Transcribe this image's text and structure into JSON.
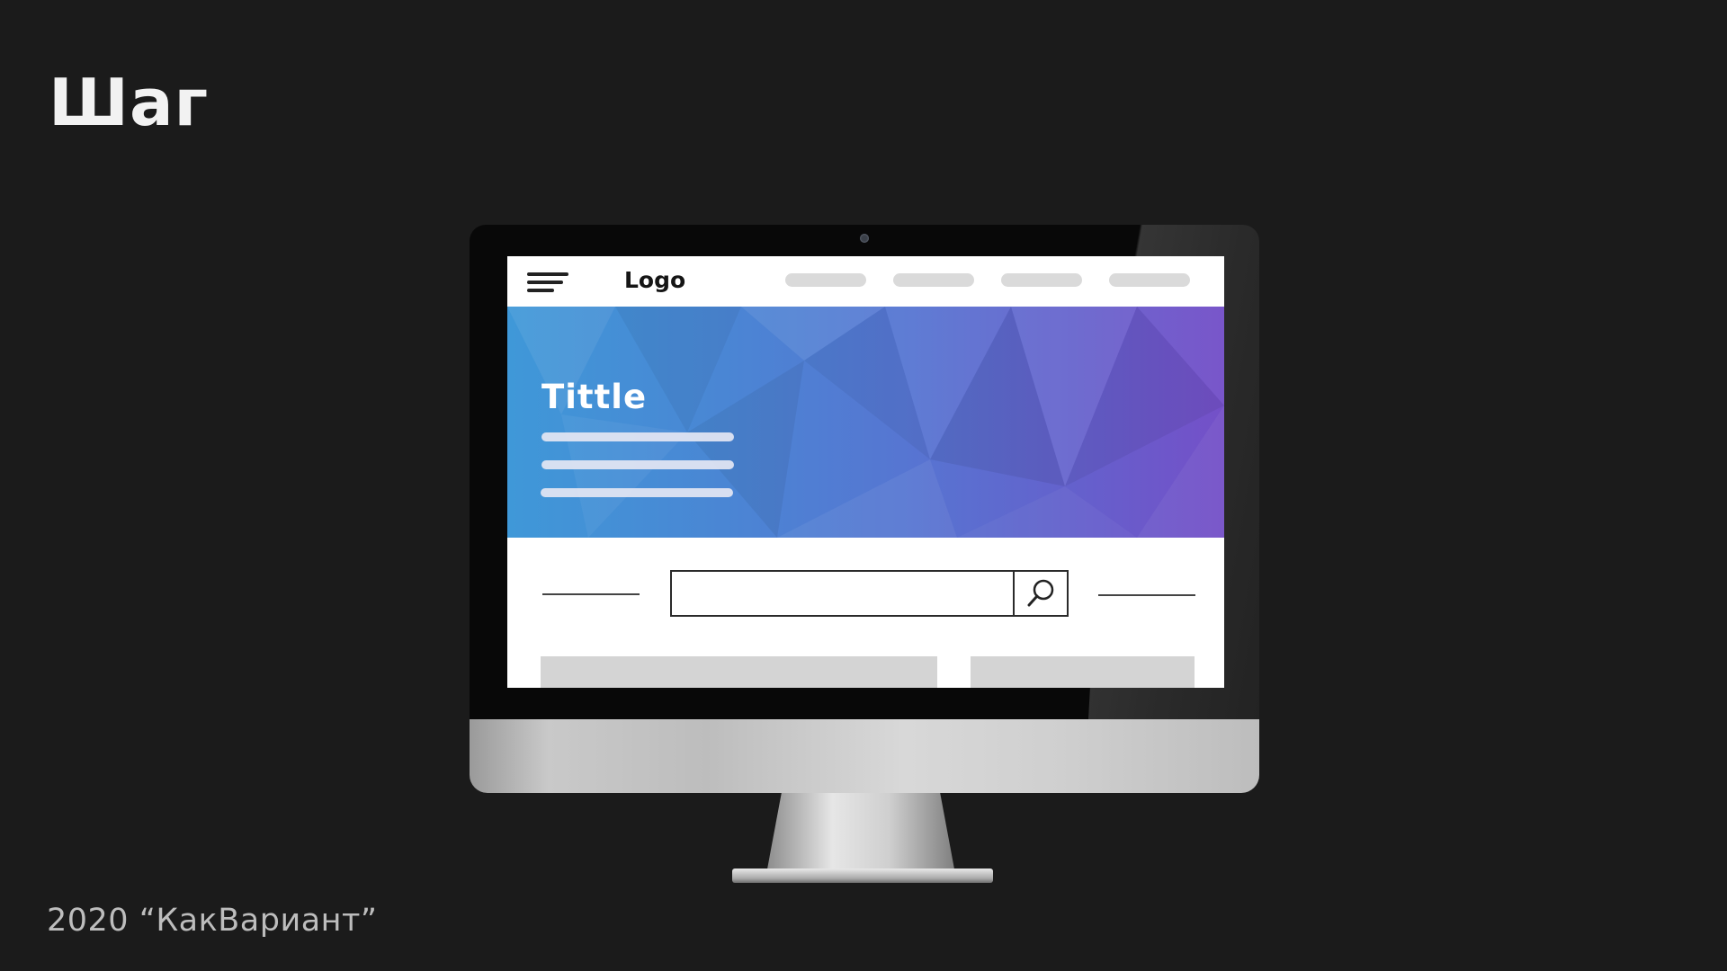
{
  "slide": {
    "title": "Шаг",
    "footer": "2020 “КакВариант”"
  },
  "website": {
    "logo": "Logo",
    "hero_title": "Tittle",
    "search": {
      "value": "",
      "placeholder": ""
    }
  },
  "icons": {
    "menu": "hamburger-menu-icon",
    "search": "search-icon",
    "camera": "camera-icon"
  },
  "colors": {
    "background": "#1b1b1b",
    "hero_start": "#3f98d8",
    "hero_end": "#7450c8",
    "placeholder_gray": "#dadada"
  }
}
